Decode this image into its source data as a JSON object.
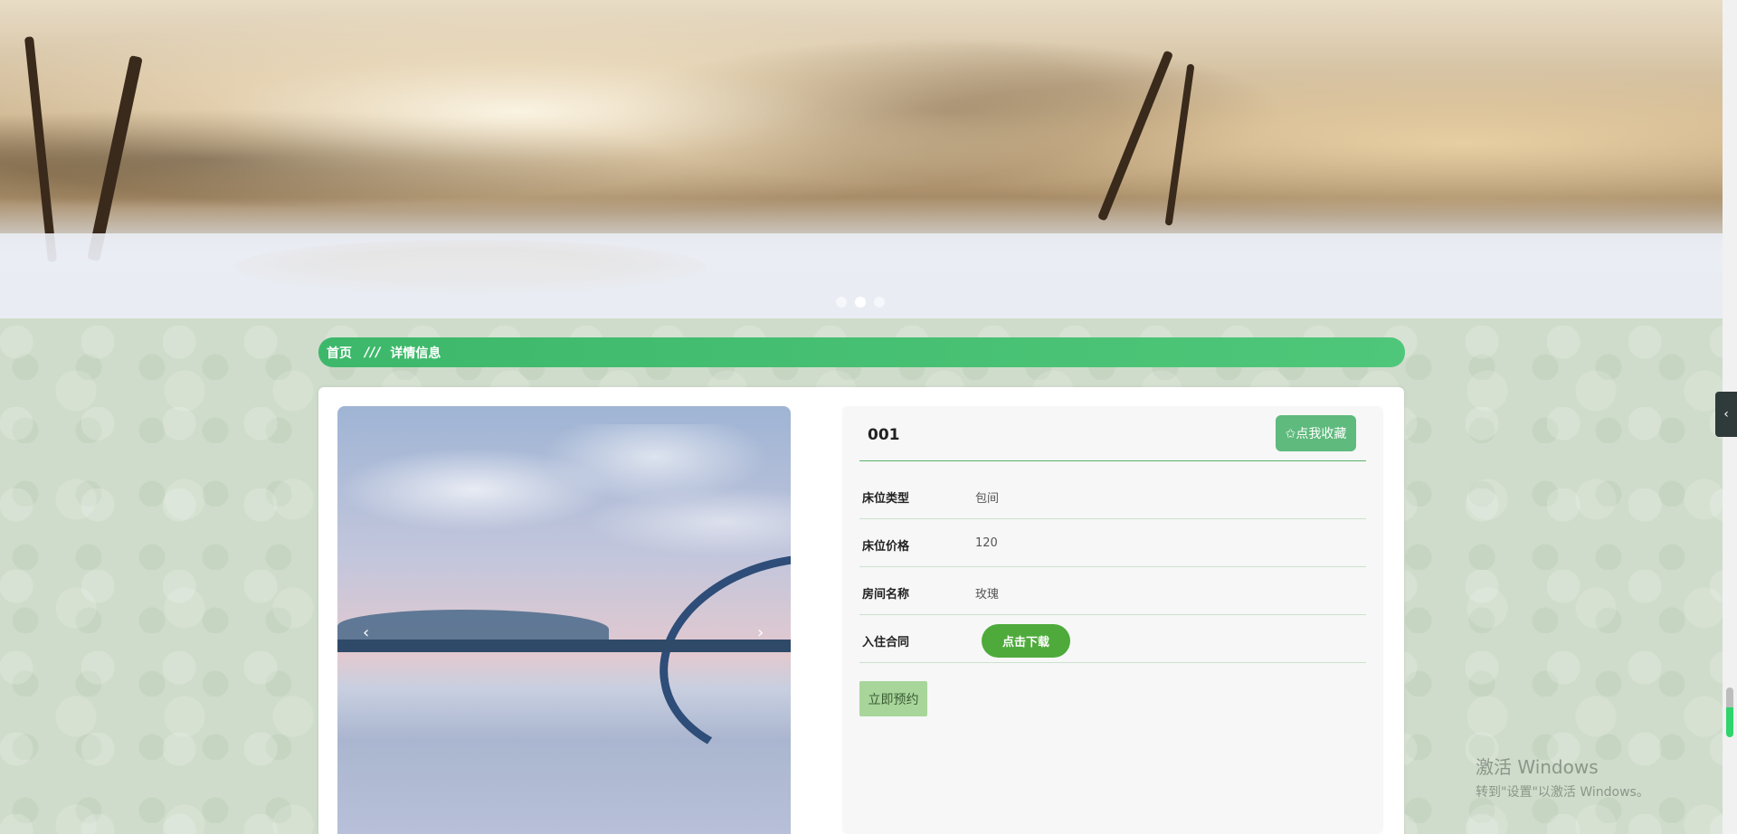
{
  "breadcrumb": {
    "home": "首页",
    "separator": "///",
    "current": "详情信息"
  },
  "carousel": {
    "dots": 3,
    "active_index": 1
  },
  "detail": {
    "title": "001",
    "favorite_label": "✩点我收藏",
    "fields": [
      {
        "label": "床位类型",
        "value": "包间"
      },
      {
        "label": "床位价格",
        "value": "120"
      },
      {
        "label": "房间名称",
        "value": "玫瑰"
      }
    ],
    "contract_label": "入住合同",
    "download_label": "点击下载",
    "book_label": "立即预约"
  },
  "gallery": {
    "prev_icon": "‹",
    "next_icon": "›"
  },
  "side_toggle": "‹",
  "watermark": {
    "line1": "激活 Windows",
    "line2": "转到\"设置\"以激活 Windows。"
  },
  "colors": {
    "accent": "#4fc77a",
    "favorite": "#5fba7d",
    "download": "#4eaa3b",
    "book": "#a8d59a"
  }
}
